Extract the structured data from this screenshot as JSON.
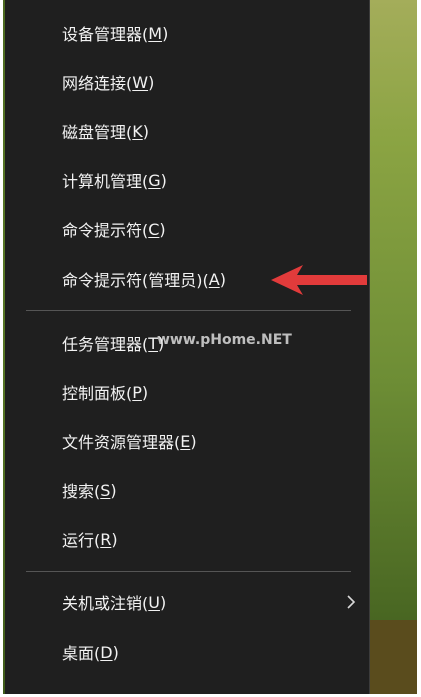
{
  "menu": {
    "items": [
      {
        "label": "设备管理器(",
        "key": "M",
        "close": ")"
      },
      {
        "label": "网络连接(",
        "key": "W",
        "close": ")"
      },
      {
        "label": "磁盘管理(",
        "key": "K",
        "close": ")"
      },
      {
        "label": "计算机管理(",
        "key": "G",
        "close": ")"
      },
      {
        "label": "命令提示符(",
        "key": "C",
        "close": ")"
      },
      {
        "label": "命令提示符(管理员)(",
        "key": "A",
        "close": ")"
      },
      {
        "label": "任务管理器(",
        "key": "T",
        "close": ")"
      },
      {
        "label": "控制面板(",
        "key": "P",
        "close": ")"
      },
      {
        "label": "文件资源管理器(",
        "key": "E",
        "close": ")"
      },
      {
        "label": "搜索(",
        "key": "S",
        "close": ")"
      },
      {
        "label": "运行(",
        "key": "R",
        "close": ")"
      },
      {
        "label": "关机或注销(",
        "key": "U",
        "close": ")"
      },
      {
        "label": "桌面(",
        "key": "D",
        "close": ")"
      }
    ]
  },
  "watermark": "www.pHome.NET",
  "colors": {
    "menu_bg": "#1f1f1f",
    "text": "#f2f2f2",
    "separator": "#555555",
    "arrow": "#e23b3b"
  }
}
